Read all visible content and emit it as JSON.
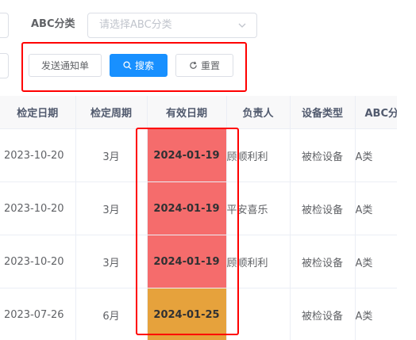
{
  "form": {
    "abc_label": "ABC分类",
    "abc_placeholder": "请选择ABC分类",
    "send_notice_label": "发送通知单",
    "search_label": "搜索",
    "reset_label": "重置"
  },
  "table": {
    "headers": [
      "检定日期",
      "检定周期",
      "有效日期",
      "负责人",
      "设备类型",
      "ABC分"
    ],
    "rows": [
      {
        "inspect_date": "2023-10-20",
        "period": "3月",
        "expire_date": "2024-01-19",
        "status": "expired",
        "owner": "顾顺利利",
        "device_type": "被检设备",
        "abc": "A类"
      },
      {
        "inspect_date": "2023-10-20",
        "period": "3月",
        "expire_date": "2024-01-19",
        "status": "expired",
        "owner": "平安喜乐",
        "device_type": "被检设备",
        "abc": "A类"
      },
      {
        "inspect_date": "2023-10-20",
        "period": "3月",
        "expire_date": "2024-01-19",
        "status": "expired",
        "owner": "顾顺利利",
        "device_type": "被检设备",
        "abc": "A类"
      },
      {
        "inspect_date": "2023-07-26",
        "period": "6月",
        "expire_date": "2024-01-25",
        "status": "warning",
        "owner": "",
        "device_type": "被检设备",
        "abc": "A类"
      }
    ]
  },
  "colors": {
    "expired": "#f56c6c",
    "warning": "#e6a23c",
    "primary": "#1890ff",
    "highlight_frame": "#ff0000"
  },
  "icons": {
    "search": "search-icon",
    "reset": "refresh-icon",
    "dropdown": "chevron-down-icon"
  }
}
